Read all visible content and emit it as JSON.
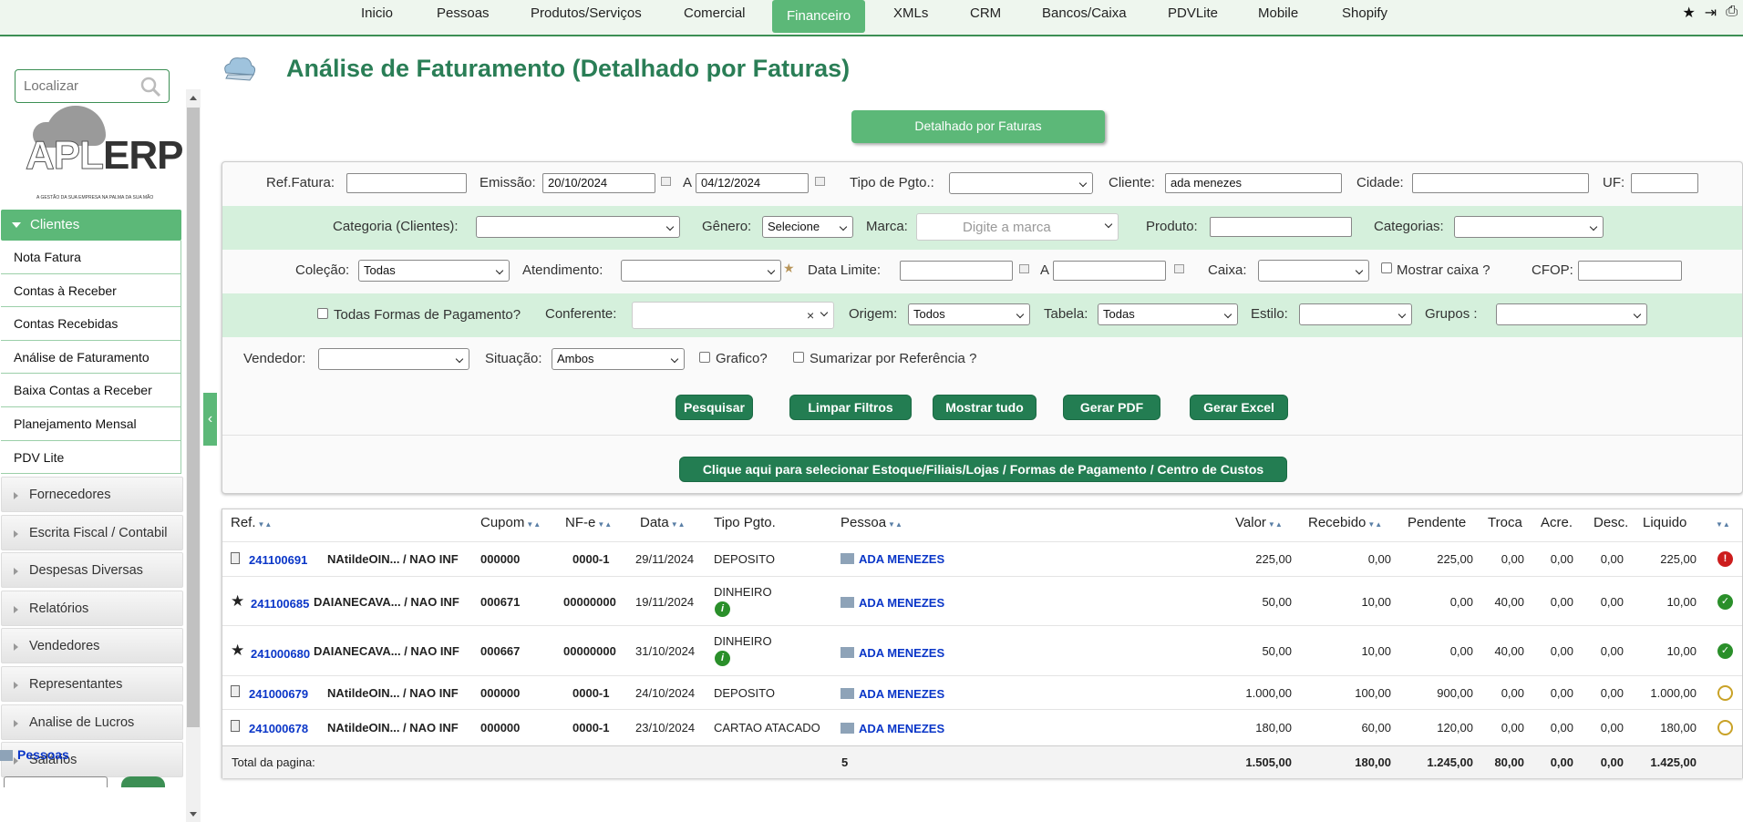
{
  "nav": {
    "items": [
      "Inicio",
      "Pessoas",
      "Produtos/Serviços",
      "Comercial",
      "Financeiro",
      "XMLs",
      "CRM",
      "Bancos/Caixa",
      "PDVLite",
      "Mobile",
      "Shopify"
    ],
    "active": "Financeiro",
    "icons": [
      "star-icon",
      "logout-icon",
      "print-icon"
    ]
  },
  "sidebar": {
    "search_placeholder": "Localizar",
    "logo_text_a": "APL",
    "logo_text_b": "ERP",
    "logo_tagline": "A GESTÃO DA SUA EMPRESA NA PALMA DA SUA MÃO",
    "active_menu": "Clientes",
    "sub_items": [
      "Nota Fatura",
      "Contas à Receber",
      "Contas Recebidas",
      "Análise de Faturamento",
      "Baixa Contas a Receber",
      "Planejamento Mensal",
      "PDV Lite"
    ],
    "groups": [
      "Fornecedores",
      "Escrita Fiscal / Contabil",
      "Despesas Diversas",
      "Relatórios",
      "Vendedores",
      "Representantes",
      "Analise de Lucros",
      "Salários"
    ],
    "bottom_link": "Pessoas"
  },
  "page": {
    "title": "Análise de Faturamento (Detalhado por Faturas)",
    "detail_button": "Detalhado por Faturas"
  },
  "filters": {
    "ref_fatura_label": "Ref.Fatura:",
    "ref_fatura_value": "",
    "emissao_label": "Emissão:",
    "emissao_from": "20/10/2024",
    "a_label": "A",
    "emissao_to": "04/12/2024",
    "tipo_pgto_label": "Tipo de Pgto.:",
    "tipo_pgto_value": "",
    "cliente_label": "Cliente:",
    "cliente_value": "ada menezes",
    "cidade_label": "Cidade:",
    "cidade_value": "",
    "uf_label": "UF:",
    "uf_value": "",
    "categoria_clientes_label": "Categoria (Clientes):",
    "categoria_clientes_value": "",
    "genero_label": "Gênero:",
    "genero_value": "Selecione",
    "marca_label": "Marca:",
    "marca_placeholder": "Digite a marca",
    "produto_label": "Produto:",
    "produto_value": "",
    "categorias_label": "Categorias:",
    "categorias_value": "",
    "colecao_label": "Coleção:",
    "colecao_value": "Todas",
    "atendimento_label": "Atendimento:",
    "atendimento_value": "",
    "data_limite_label": "Data Limite:",
    "data_limite_from": "",
    "data_limite_to": "",
    "caixa_label": "Caixa:",
    "caixa_value": "",
    "mostrar_caixa_label": "Mostrar caixa ?",
    "cfop_label": "CFOP:",
    "cfop_value": "",
    "todas_formas_label": "Todas Formas de Pagamento?",
    "conferente_label": "Conferente:",
    "conferente_value": "",
    "origem_label": "Origem:",
    "origem_value": "Todos",
    "tabela_label": "Tabela:",
    "tabela_value": "Todas",
    "estilo_label": "Estilo:",
    "estilo_value": "",
    "grupos_label": "Grupos :",
    "grupos_value": "",
    "vendedor_label": "Vendedor:",
    "vendedor_value": "",
    "situacao_label": "Situação:",
    "situacao_value": "Ambos",
    "grafico_label": "Grafico?",
    "sumarizar_label": "Sumarizar por Referência ?"
  },
  "actions": {
    "pesquisar": "Pesquisar",
    "limpar": "Limpar Filtros",
    "mostrar_tudo": "Mostrar tudo",
    "gerar_pdf": "Gerar PDF",
    "gerar_excel": "Gerar Excel",
    "selecionar_estoque": "Clique aqui para selecionar Estoque/Filiais/Lojas / Formas de Pagamento / Centro de Custos"
  },
  "table": {
    "headers": {
      "ref": "Ref.",
      "cupom": "Cupom",
      "nfe": "NF-e",
      "data": "Data",
      "tipo": "Tipo Pgto.",
      "pessoa": "Pessoa",
      "valor": "Valor",
      "recebido": "Recebido",
      "pendente": "Pendente",
      "troca": "Troca",
      "acre": "Acre.",
      "desc": "Desc.",
      "liquido": "Liquido"
    },
    "rows": [
      {
        "ref": "241100691",
        "vend": "NAtildeOIN... / NAO INF",
        "cupom": "000000",
        "nfe": "0000-1",
        "data": "29/11/2024",
        "tipo": "DEPOSITO",
        "pessoa": "ADA MENEZES",
        "valor": "225,00",
        "recebido": "0,00",
        "pendente": "225,00",
        "troca": "0,00",
        "acre": "0,00",
        "desc": "0,00",
        "liquido": "225,00",
        "status": "pending-red"
      },
      {
        "ref": "241100685",
        "vend": "DAIANECAVA... / NAO INF",
        "cupom": "000671",
        "nfe": "00000000",
        "data": "19/11/2024",
        "tipo": "DINHEIRO",
        "pessoa": "ADA MENEZES",
        "valor": "50,00",
        "recebido": "10,00",
        "pendente": "0,00",
        "troca": "40,00",
        "acre": "0,00",
        "desc": "0,00",
        "liquido": "10,00",
        "status": "paid"
      },
      {
        "ref": "241000680",
        "vend": "DAIANECAVA... / NAO INF",
        "cupom": "000667",
        "nfe": "00000000",
        "data": "31/10/2024",
        "tipo": "DINHEIRO",
        "pessoa": "ADA MENEZES",
        "valor": "50,00",
        "recebido": "10,00",
        "pendente": "0,00",
        "troca": "40,00",
        "acre": "0,00",
        "desc": "0,00",
        "liquido": "10,00",
        "status": "paid"
      },
      {
        "ref": "241000679",
        "vend": "NAtildeOIN... / NAO INF",
        "cupom": "000000",
        "nfe": "0000-1",
        "data": "24/10/2024",
        "tipo": "DEPOSITO",
        "pessoa": "ADA MENEZES",
        "valor": "1.000,00",
        "recebido": "100,00",
        "pendente": "900,00",
        "troca": "0,00",
        "acre": "0,00",
        "desc": "0,00",
        "liquido": "1.000,00",
        "status": "open"
      },
      {
        "ref": "241000678",
        "vend": "NAtildeOIN... / NAO INF",
        "cupom": "000000",
        "nfe": "0000-1",
        "data": "23/10/2024",
        "tipo": "CARTAO ATACADO",
        "pessoa": "ADA MENEZES",
        "valor": "180,00",
        "recebido": "60,00",
        "pendente": "120,00",
        "troca": "0,00",
        "acre": "0,00",
        "desc": "0,00",
        "liquido": "180,00",
        "status": "open"
      }
    ],
    "total": {
      "label": "Total da pagina:",
      "count": "5",
      "valor": "1.505,00",
      "recebido": "180,00",
      "pendente": "1.245,00",
      "troca": "80,00",
      "acre": "0,00",
      "desc": "0,00",
      "liquido": "1.425,00"
    }
  },
  "colors": {
    "primary_green": "#5cb878",
    "dark_green": "#237d52",
    "title_green": "#2a7e56",
    "link_blue": "#0a36c8",
    "row_highlight": "#d5f0dc"
  }
}
